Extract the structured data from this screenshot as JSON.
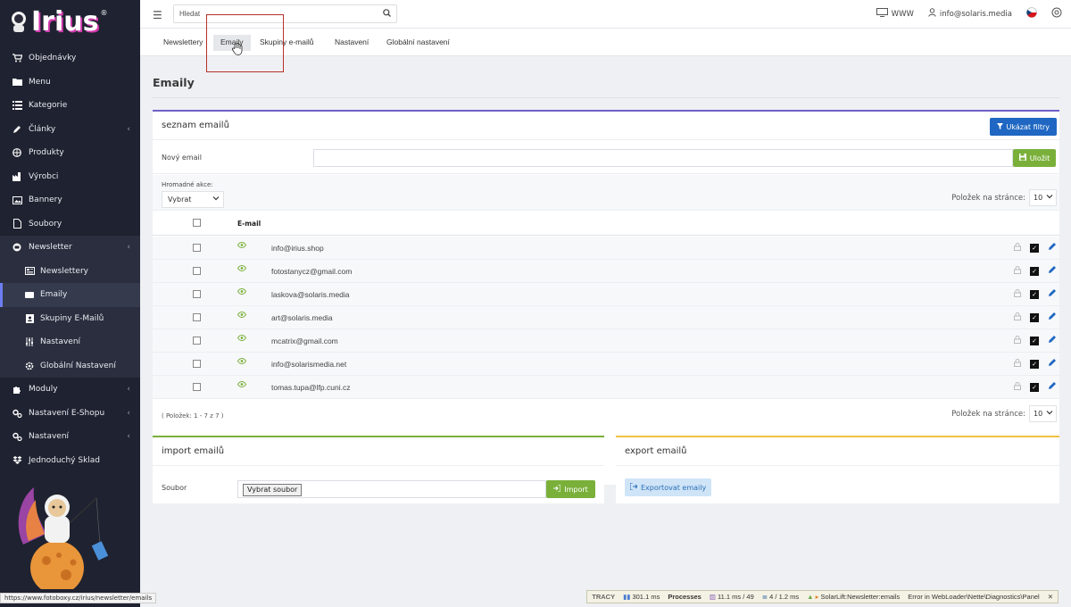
{
  "app": {
    "logo_text": "Irius",
    "logo_mark": "®"
  },
  "sidebar": {
    "items": [
      {
        "label": "Objednávky",
        "icon": "cart-icon"
      },
      {
        "label": "Menu",
        "icon": "folder-icon"
      },
      {
        "label": "Kategorie",
        "icon": "list-icon"
      },
      {
        "label": "Články",
        "icon": "pencil-icon",
        "chevron": "‹"
      },
      {
        "label": "Produkty",
        "icon": "basketball-icon"
      },
      {
        "label": "Výrobci",
        "icon": "factory-icon"
      },
      {
        "label": "Bannery",
        "icon": "image-icon"
      },
      {
        "label": "Soubory",
        "icon": "file-icon"
      },
      {
        "label": "Newsletter",
        "icon": "newsletter-icon",
        "chevron": "‹"
      }
    ],
    "newsletter_sub": [
      {
        "label": "Newslettery",
        "icon": "newspaper-icon"
      },
      {
        "label": "Emaily",
        "icon": "envelope-icon"
      },
      {
        "label": "Skupiny E-Mailů",
        "icon": "address-book-icon"
      },
      {
        "label": "Nastavení",
        "icon": "sliders-icon"
      },
      {
        "label": "Globální Nastavení",
        "icon": "gear-icon"
      }
    ],
    "bottom_items": [
      {
        "label": "Moduly",
        "icon": "puzzle-icon",
        "chevron": "‹"
      },
      {
        "label": "Nastavení E-Shopu",
        "icon": "cogs-icon",
        "chevron": "‹"
      },
      {
        "label": "Nastavení",
        "icon": "cogs-icon",
        "chevron": "‹"
      },
      {
        "label": "Jednoduchý Sklad",
        "icon": "dropbox-icon"
      }
    ],
    "status_url": "https://www.fotoboxy.cz/irius/newsletter/emails"
  },
  "topbar": {
    "search_placeholder": "Hledat",
    "www_label": "WWW",
    "user_email": "info@solaris.media"
  },
  "subnav": {
    "tabs": [
      "Newslettery",
      "Emaily",
      "Skupiny e-mailů",
      "Nastavení",
      "Globální nastavení"
    ],
    "active": "Emaily"
  },
  "page": {
    "title": "Emaily"
  },
  "list": {
    "header": "seznam emailů",
    "filters_button": "Ukázat filtry",
    "new_email_label": "Nový email",
    "save_button": "Uložit",
    "bulk_label": "Hromadné akce:",
    "bulk_value": "Vybrat",
    "perpage_label": "Položek na stránce:",
    "perpage_value": "10",
    "column_email": "E-mail",
    "rows": [
      "info@irius.shop",
      "fotostanycz@gmail.com",
      "laskova@solaris.media",
      "art@solaris.media",
      "mcatrix@gmail.com",
      "info@solarismedia.net",
      "tomas.tupa@lfp.cuni.cz"
    ],
    "count_text": "( Položek: 1 - 7 z 7 )"
  },
  "import": {
    "header": "import emailů",
    "file_label": "Soubor",
    "file_button": "Vybrat soubor",
    "import_button": "Import"
  },
  "export": {
    "header": "export emailů",
    "export_button": "Exportovat emaily"
  },
  "tracy": {
    "logo": "TRACY",
    "time": "301.1 ms",
    "processes": "Processes",
    "memory": "11.1 ms / 49",
    "db": "4 / 1.2 ms",
    "presenter": "SolarLift:Newsletter:emails",
    "error": "Error in WebLoader\\Nette\\Diagnostics\\Panel",
    "close": "✕"
  },
  "colors": {
    "sidebar_bg": "#1f2230",
    "accent_blue": "#1f67c2",
    "accent_green": "#7ab03a",
    "list_border": "#6f5fc8",
    "export_border": "#f0c040",
    "highlight_red": "#b8302a"
  }
}
